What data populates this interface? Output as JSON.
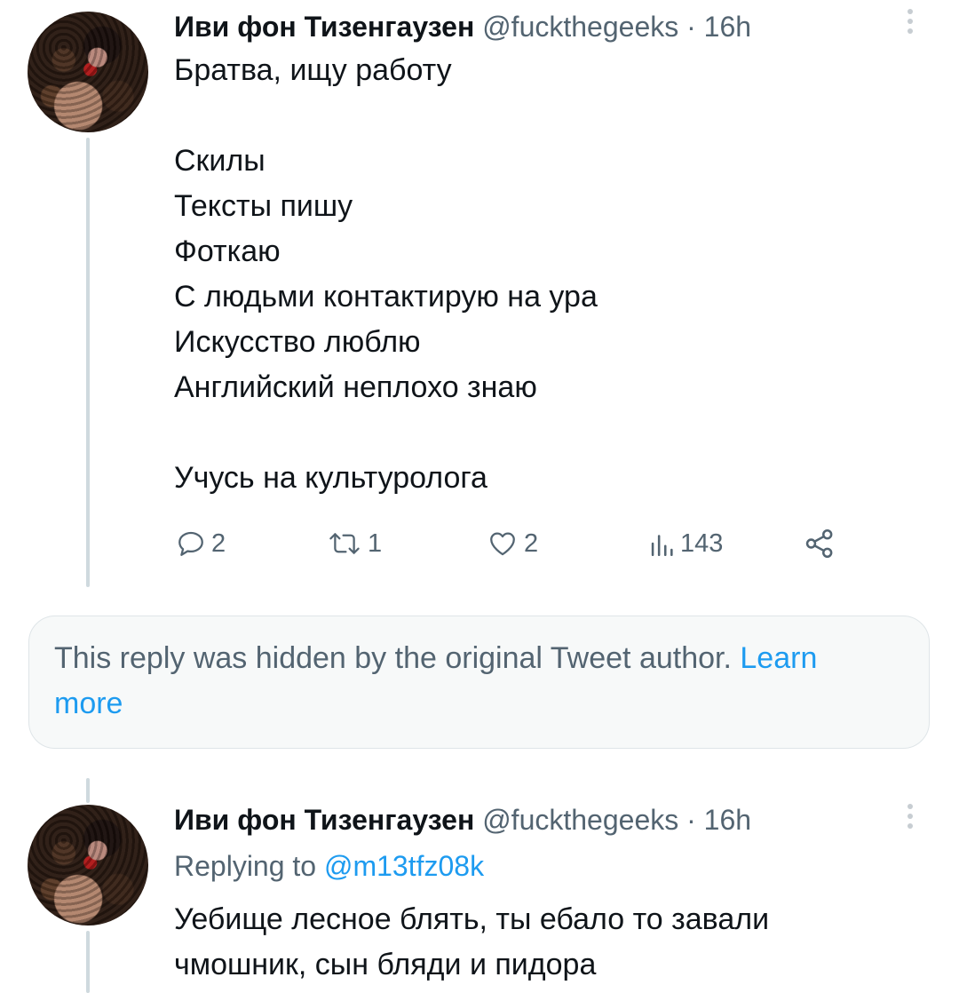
{
  "tweets": [
    {
      "author_name": "Иви фон Тизенгаузен",
      "handle": "@fuckthegeeks",
      "separator": "·",
      "time": "16h",
      "lines": [
        "Братва, ищу работу",
        "",
        "Скилы",
        "Тексты пишу",
        "Фоткаю",
        "С людьми контактирую на ура",
        "Искусство люблю",
        "Английский неплохо знаю",
        "",
        "Учусь на культуролога"
      ],
      "actions": {
        "replies": "2",
        "retweets": "1",
        "likes": "2",
        "views": "143"
      }
    },
    {
      "author_name": "Иви фон Тизенгаузен",
      "handle": "@fuckthegeeks",
      "separator": "·",
      "time": "16h",
      "replying_prefix": "Replying to",
      "replying_handle": "@m13tfz08k",
      "lines": [
        "Уебище лесное блять, ты ебало то завали",
        "чмошник, сын бляди и пидора"
      ]
    }
  ],
  "hidden_notice": {
    "text": "This reply was hidden by the original Tweet author.",
    "link": "Learn",
    "link2": "more"
  },
  "colors": {
    "text": "#0f1419",
    "muted": "#536471",
    "accent": "#1d9bf0",
    "thread_line": "#cfd9de",
    "notice_bg": "#f7f9f9"
  },
  "icons": [
    "reply-icon",
    "retweet-icon",
    "like-icon",
    "views-icon",
    "share-icon",
    "more-icon"
  ]
}
